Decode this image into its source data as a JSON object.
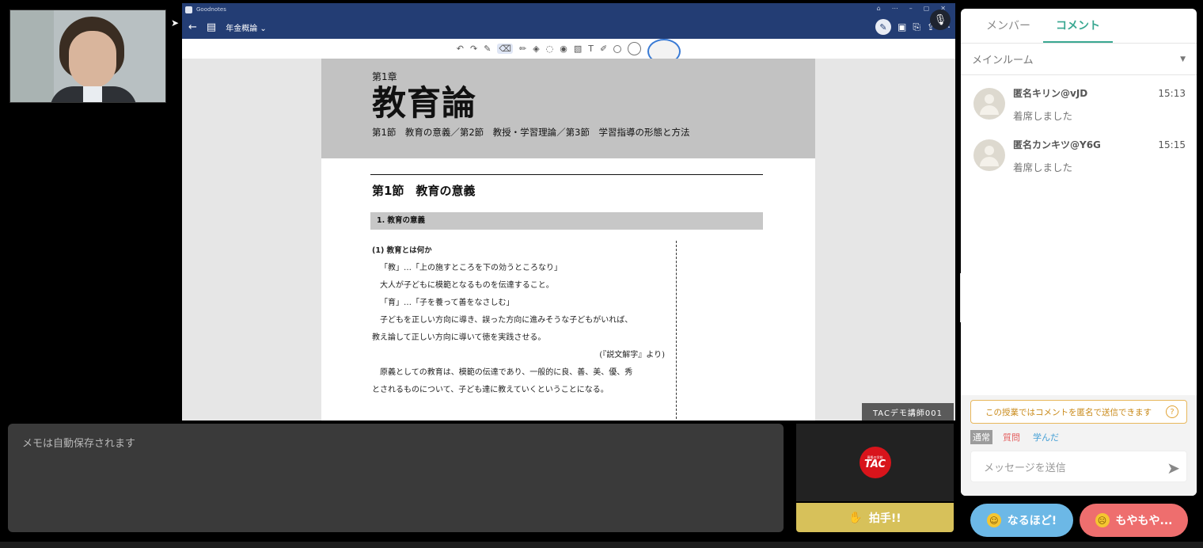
{
  "goodnotes": {
    "app_name": "Goodnotes",
    "notebook_title": "年金概論",
    "speaker_tag": "TACデモ講師001"
  },
  "page": {
    "chapter_label": "第1章",
    "chapter_title": "教育論",
    "chapter_subtitle": "第1節　教育の意義／第2節　教授・学習理論／第3節　学習指導の形態と方法",
    "section_title": "第1節　教育の意義",
    "subsection_bar": "1. 教育の意義",
    "question": "(1) 教育とは何か",
    "lines": [
      "「教」…「上の施すところを下の効うところなり」",
      "大人が子どもに模範となるものを伝達すること。",
      "「育」…「子を養って善をなさしむ」",
      "子どもを正しい方向に導き、誤った方向に進みそうな子どもがいれば、",
      "教え論して正しい方向に導いて徳を実践させる。",
      "(『説文解字』より)",
      "原義としての教育は、模範の伝達であり、一般的に良、善、美、優、秀",
      "とされるものについて、子ども達に教えていくということになる。"
    ]
  },
  "memo": {
    "placeholder": "メモは自動保存されます"
  },
  "tac": {
    "logo_small": "資格の学校",
    "logo_text": "TAC",
    "clap_label": "拍手!!"
  },
  "sidebar": {
    "tabs": [
      "メンバー",
      "コメント"
    ],
    "room": "メインルーム",
    "comments": [
      {
        "name": "匿名キリン@vJD",
        "time": "15:13",
        "message": "着席しました"
      },
      {
        "name": "匿名カンキツ@Y6G",
        "time": "15:15",
        "message": "着席しました"
      }
    ],
    "anon_note": "この授業ではコメントを匿名で送信できます",
    "modes": [
      "通常",
      "質問",
      "学んだ"
    ],
    "input_placeholder": "メッセージを送信"
  },
  "reactions": {
    "naruhodo": "なるほど!",
    "moyamoya": "もやもや..."
  }
}
